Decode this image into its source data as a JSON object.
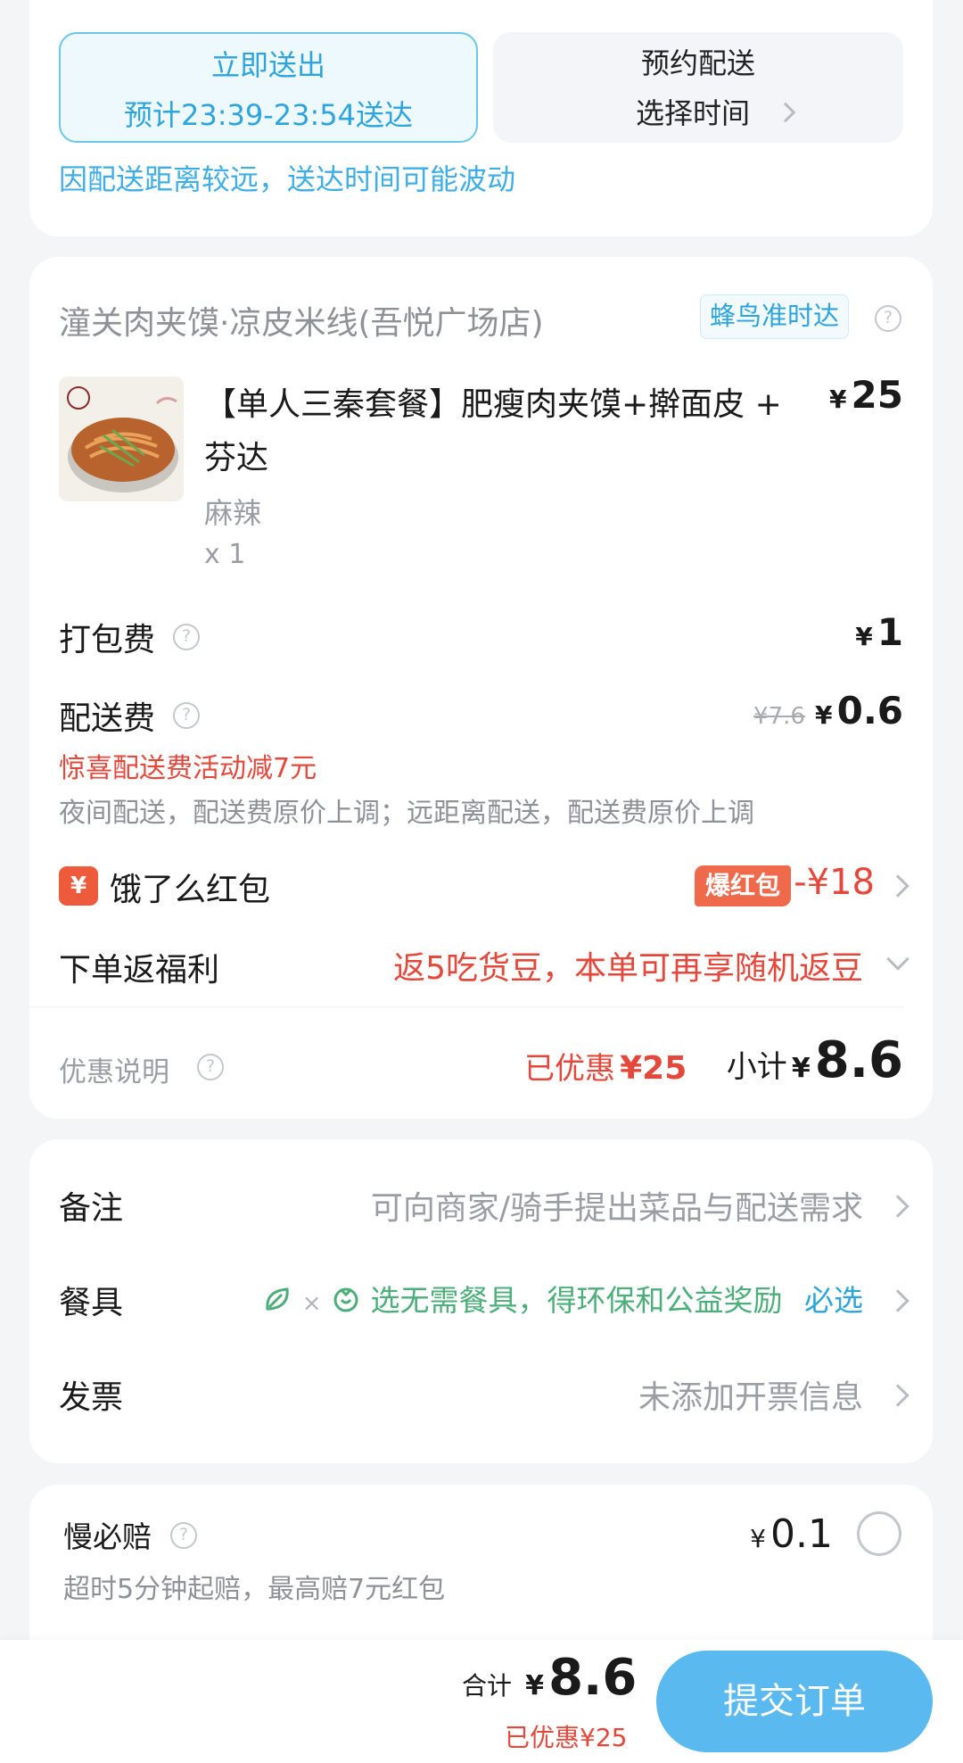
{
  "delivery": {
    "now": {
      "title": "立即送出",
      "eta": "预计23:39-23:54送达"
    },
    "schedule": {
      "title": "预约配送",
      "sub": "选择时间"
    },
    "notice": "因配送距离较远，送达时间可能波动"
  },
  "store": {
    "name": "潼关肉夹馍·凉皮米线(吾悦广场店)",
    "badge": "蜂鸟准时达"
  },
  "item": {
    "title_line1": "【单人三秦套餐】肥瘦肉夹馍+擀面皮 +",
    "title_line2": "芬达",
    "spec": "麻辣",
    "qty": "x 1",
    "currency": "¥",
    "price": "25"
  },
  "fees": {
    "packing": {
      "label": "打包费",
      "currency": "¥",
      "amount": "1"
    },
    "delivery": {
      "label": "配送费",
      "original": "¥7.6",
      "currency": "¥",
      "amount": "0.6",
      "promo": "惊喜配送费活动减7元",
      "note": "夜间配送，配送费原价上调；远距离配送，配送费原价上调"
    }
  },
  "redpacket": {
    "icon_char": "¥",
    "label": "饿了么红包",
    "tag": "爆红包",
    "amount": "-¥18"
  },
  "rebate": {
    "label": "下单返福利",
    "text": "返5吃货豆，本单可再享随机返豆"
  },
  "summary": {
    "discount_label": "优惠说明",
    "saved_prefix": "已优惠",
    "saved_amount": "¥25",
    "subtotal_label": "小计",
    "currency": "¥",
    "subtotal": "8.6"
  },
  "options": {
    "remark": {
      "label": "备注",
      "value": "可向商家/骑手提出菜品与配送需求"
    },
    "tableware": {
      "label": "餐具",
      "times": "×",
      "value": "选无需餐具，得环保和公益奖励",
      "required": "必选"
    },
    "invoice": {
      "label": "发票",
      "value": "未添加开票信息"
    }
  },
  "insurance": {
    "label": "慢必赔",
    "desc": "超时5分钟起赔，最高赔7元红包",
    "currency": "¥",
    "price": "0.1"
  },
  "footer": {
    "total_label": "合计",
    "currency": "¥",
    "total": "8.6",
    "saved": "已优惠¥25",
    "submit": "提交订单"
  },
  "colors": {
    "accent_blue": "#3eaee8",
    "promo_red": "#e5473b",
    "eco_green": "#4caf7a",
    "submit_bg": "#5ab9ef"
  }
}
